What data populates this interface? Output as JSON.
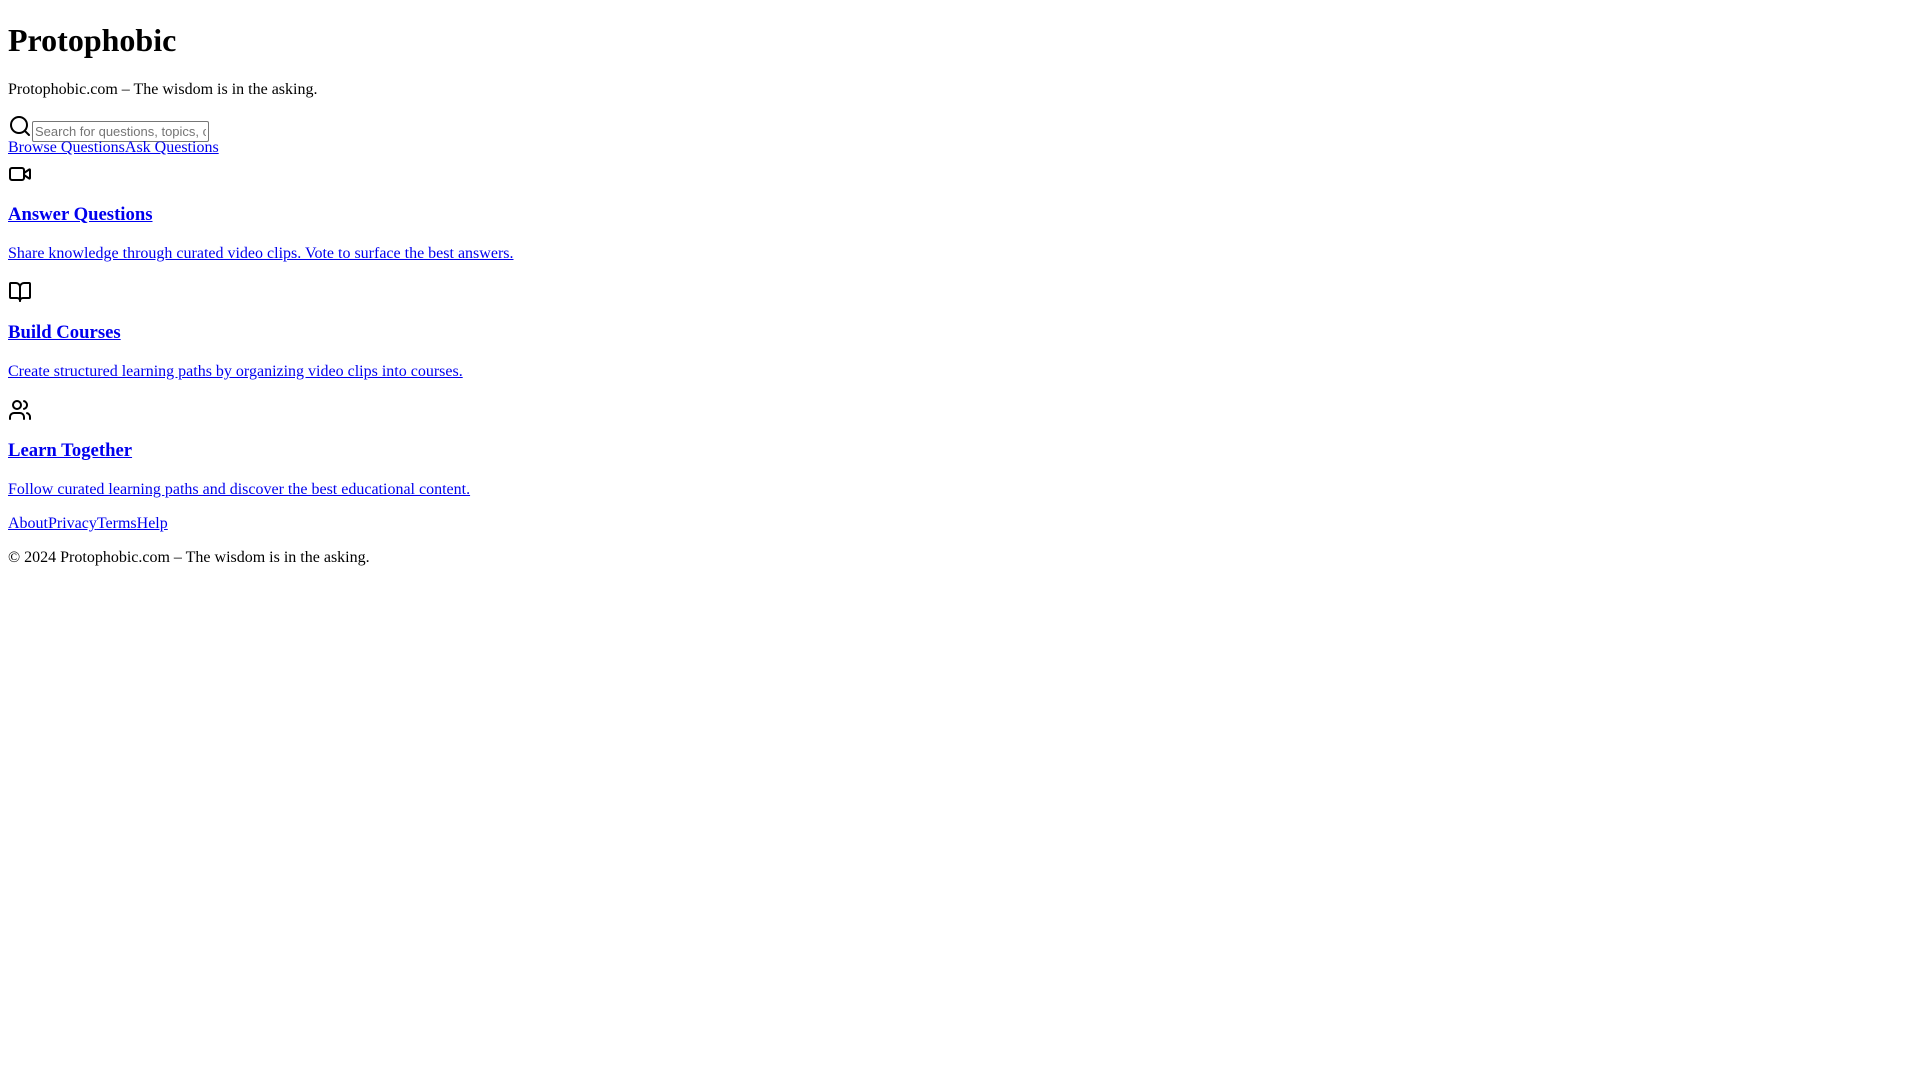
{
  "header": {
    "title": "Protophobic",
    "tagline": "Protophobic.com – The wisdom is in the asking."
  },
  "search": {
    "icon": "search-icon",
    "placeholder": "Search for questions, topics, or answers...",
    "value": ""
  },
  "nav": {
    "items": [
      {
        "label": "Browse Questions"
      },
      {
        "label": "Ask Questions"
      }
    ]
  },
  "features": [
    {
      "icon": "video-icon",
      "title": "Answer Questions",
      "description": "Share knowledge through curated video clips. Vote to surface the best answers."
    },
    {
      "icon": "book-open-icon",
      "title": "Build Courses",
      "description": "Create structured learning paths by organizing video clips into courses."
    },
    {
      "icon": "users-icon",
      "title": "Learn Together",
      "description": "Follow curated learning paths and discover the best educational content."
    }
  ],
  "footer": {
    "links": [
      {
        "label": "About"
      },
      {
        "label": "Privacy"
      },
      {
        "label": "Terms"
      },
      {
        "label": "Help"
      }
    ],
    "copyright": "© 2024 Protophobic.com – The wisdom is in the asking."
  },
  "colors": {
    "link": "#0000ee",
    "text": "#000000",
    "background": "#ffffff"
  }
}
